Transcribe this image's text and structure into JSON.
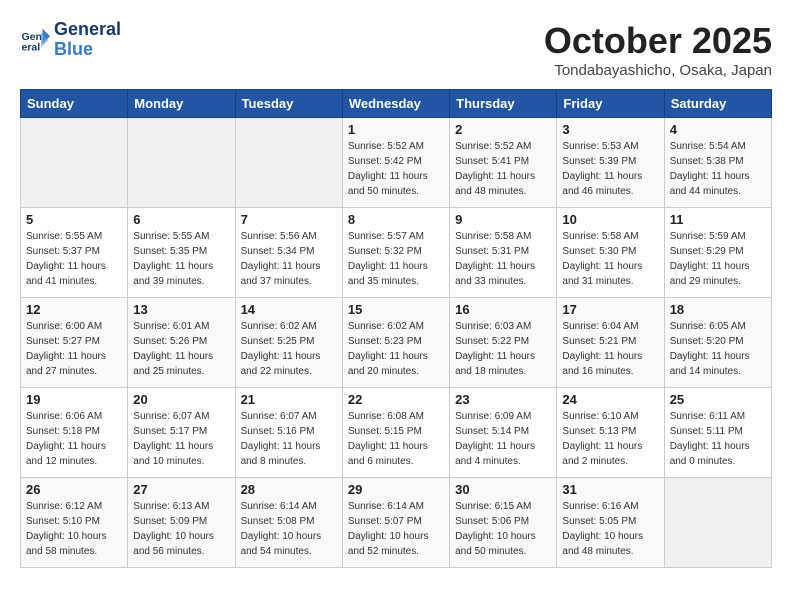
{
  "header": {
    "logo_line1": "General",
    "logo_line2": "Blue",
    "month": "October 2025",
    "location": "Tondabayashicho, Osaka, Japan"
  },
  "days_of_week": [
    "Sunday",
    "Monday",
    "Tuesday",
    "Wednesday",
    "Thursday",
    "Friday",
    "Saturday"
  ],
  "weeks": [
    [
      {
        "day": "",
        "info": ""
      },
      {
        "day": "",
        "info": ""
      },
      {
        "day": "",
        "info": ""
      },
      {
        "day": "1",
        "info": "Sunrise: 5:52 AM\nSunset: 5:42 PM\nDaylight: 11 hours\nand 50 minutes."
      },
      {
        "day": "2",
        "info": "Sunrise: 5:52 AM\nSunset: 5:41 PM\nDaylight: 11 hours\nand 48 minutes."
      },
      {
        "day": "3",
        "info": "Sunrise: 5:53 AM\nSunset: 5:39 PM\nDaylight: 11 hours\nand 46 minutes."
      },
      {
        "day": "4",
        "info": "Sunrise: 5:54 AM\nSunset: 5:38 PM\nDaylight: 11 hours\nand 44 minutes."
      }
    ],
    [
      {
        "day": "5",
        "info": "Sunrise: 5:55 AM\nSunset: 5:37 PM\nDaylight: 11 hours\nand 41 minutes."
      },
      {
        "day": "6",
        "info": "Sunrise: 5:55 AM\nSunset: 5:35 PM\nDaylight: 11 hours\nand 39 minutes."
      },
      {
        "day": "7",
        "info": "Sunrise: 5:56 AM\nSunset: 5:34 PM\nDaylight: 11 hours\nand 37 minutes."
      },
      {
        "day": "8",
        "info": "Sunrise: 5:57 AM\nSunset: 5:32 PM\nDaylight: 11 hours\nand 35 minutes."
      },
      {
        "day": "9",
        "info": "Sunrise: 5:58 AM\nSunset: 5:31 PM\nDaylight: 11 hours\nand 33 minutes."
      },
      {
        "day": "10",
        "info": "Sunrise: 5:58 AM\nSunset: 5:30 PM\nDaylight: 11 hours\nand 31 minutes."
      },
      {
        "day": "11",
        "info": "Sunrise: 5:59 AM\nSunset: 5:29 PM\nDaylight: 11 hours\nand 29 minutes."
      }
    ],
    [
      {
        "day": "12",
        "info": "Sunrise: 6:00 AM\nSunset: 5:27 PM\nDaylight: 11 hours\nand 27 minutes."
      },
      {
        "day": "13",
        "info": "Sunrise: 6:01 AM\nSunset: 5:26 PM\nDaylight: 11 hours\nand 25 minutes."
      },
      {
        "day": "14",
        "info": "Sunrise: 6:02 AM\nSunset: 5:25 PM\nDaylight: 11 hours\nand 22 minutes."
      },
      {
        "day": "15",
        "info": "Sunrise: 6:02 AM\nSunset: 5:23 PM\nDaylight: 11 hours\nand 20 minutes."
      },
      {
        "day": "16",
        "info": "Sunrise: 6:03 AM\nSunset: 5:22 PM\nDaylight: 11 hours\nand 18 minutes."
      },
      {
        "day": "17",
        "info": "Sunrise: 6:04 AM\nSunset: 5:21 PM\nDaylight: 11 hours\nand 16 minutes."
      },
      {
        "day": "18",
        "info": "Sunrise: 6:05 AM\nSunset: 5:20 PM\nDaylight: 11 hours\nand 14 minutes."
      }
    ],
    [
      {
        "day": "19",
        "info": "Sunrise: 6:06 AM\nSunset: 5:18 PM\nDaylight: 11 hours\nand 12 minutes."
      },
      {
        "day": "20",
        "info": "Sunrise: 6:07 AM\nSunset: 5:17 PM\nDaylight: 11 hours\nand 10 minutes."
      },
      {
        "day": "21",
        "info": "Sunrise: 6:07 AM\nSunset: 5:16 PM\nDaylight: 11 hours\nand 8 minutes."
      },
      {
        "day": "22",
        "info": "Sunrise: 6:08 AM\nSunset: 5:15 PM\nDaylight: 11 hours\nand 6 minutes."
      },
      {
        "day": "23",
        "info": "Sunrise: 6:09 AM\nSunset: 5:14 PM\nDaylight: 11 hours\nand 4 minutes."
      },
      {
        "day": "24",
        "info": "Sunrise: 6:10 AM\nSunset: 5:13 PM\nDaylight: 11 hours\nand 2 minutes."
      },
      {
        "day": "25",
        "info": "Sunrise: 6:11 AM\nSunset: 5:11 PM\nDaylight: 11 hours\nand 0 minutes."
      }
    ],
    [
      {
        "day": "26",
        "info": "Sunrise: 6:12 AM\nSunset: 5:10 PM\nDaylight: 10 hours\nand 58 minutes."
      },
      {
        "day": "27",
        "info": "Sunrise: 6:13 AM\nSunset: 5:09 PM\nDaylight: 10 hours\nand 56 minutes."
      },
      {
        "day": "28",
        "info": "Sunrise: 6:14 AM\nSunset: 5:08 PM\nDaylight: 10 hours\nand 54 minutes."
      },
      {
        "day": "29",
        "info": "Sunrise: 6:14 AM\nSunset: 5:07 PM\nDaylight: 10 hours\nand 52 minutes."
      },
      {
        "day": "30",
        "info": "Sunrise: 6:15 AM\nSunset: 5:06 PM\nDaylight: 10 hours\nand 50 minutes."
      },
      {
        "day": "31",
        "info": "Sunrise: 6:16 AM\nSunset: 5:05 PM\nDaylight: 10 hours\nand 48 minutes."
      },
      {
        "day": "",
        "info": ""
      }
    ]
  ]
}
